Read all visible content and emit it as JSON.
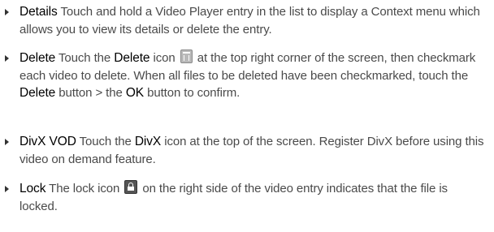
{
  "items": [
    {
      "term": "Details",
      "text": "  Touch and hold a Video Player entry in the list to display a Context menu which allows you to view its details or delete the entry."
    },
    {
      "term": "Delete",
      "t1": "  Touch the ",
      "b1": "Delete",
      "t2": " icon ",
      "icon": "trash-icon",
      "t3": " at the top right corner of the screen, then checkmark each video to delete. When all files to be deleted have been checkmarked, touch the ",
      "b2": "Delete",
      "t4": " button > the ",
      "b3": "OK",
      "t5": " button to confirm."
    },
    {
      "term": "DivX VOD",
      "t1": "  Touch the ",
      "b1": "DivX",
      "t2": " icon at the top of the screen. Register DivX before using this video on demand feature."
    },
    {
      "term": "Lock",
      "t1": " The lock icon ",
      "icon": "lock-icon",
      "t2": " on the right side of the video entry indicates that the file is locked."
    }
  ]
}
